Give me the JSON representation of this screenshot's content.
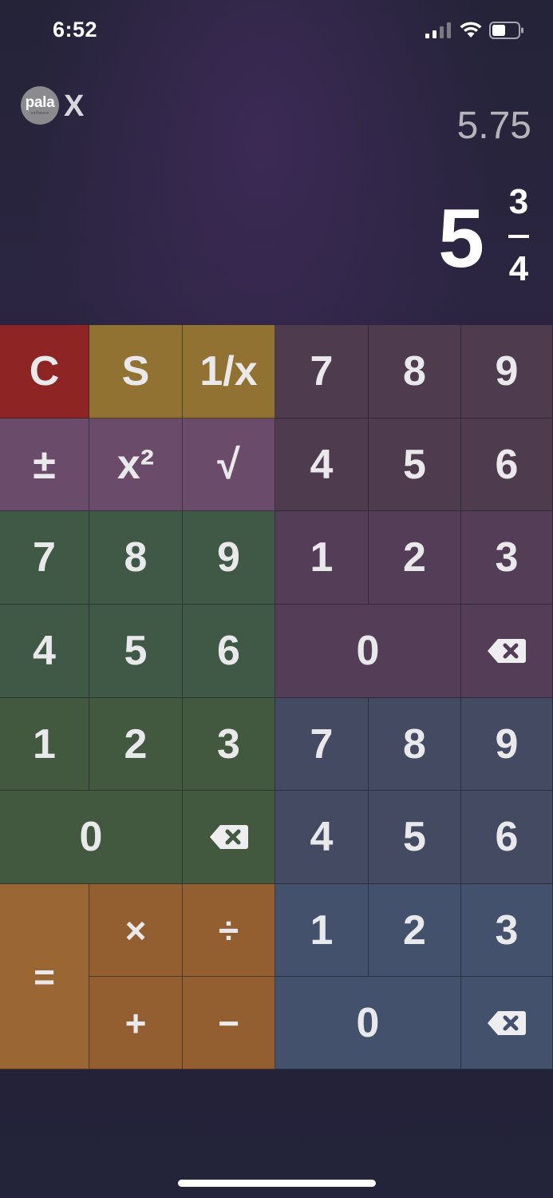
{
  "status": {
    "time": "6:52"
  },
  "logo": {
    "brand": "pala",
    "sub": "software",
    "x_label": "X"
  },
  "display": {
    "decimal": "5.75",
    "fraction": {
      "whole": "5",
      "numerator": "3",
      "denominator": "4"
    }
  },
  "keys": {
    "clear": "C",
    "s": "S",
    "reciprocal": "1/x",
    "plusminus": "±",
    "square": "x²",
    "sqrt": "√",
    "equals": "=",
    "multiply": "×",
    "divide": "÷",
    "plus": "+",
    "minus": "−",
    "whole": {
      "d7": "7",
      "d8": "8",
      "d9": "9",
      "d4": "4",
      "d5": "5",
      "d6": "6",
      "d1": "1",
      "d2": "2",
      "d3": "3",
      "d0": "0"
    },
    "numerator": {
      "d7": "7",
      "d8": "8",
      "d9": "9",
      "d4": "4",
      "d5": "5",
      "d6": "6",
      "d1": "1",
      "d2": "2",
      "d3": "3",
      "d0": "0"
    },
    "denominator": {
      "d7": "7",
      "d8": "8",
      "d9": "9",
      "d4": "4",
      "d5": "5",
      "d6": "6",
      "d1": "1",
      "d2": "2",
      "d3": "3",
      "d0": "0"
    }
  },
  "colors": {
    "clear": "#8f2424",
    "function_gold": "#927232",
    "function_pink": "#6a4b69",
    "whole_pad": "#3f5946",
    "numerator_pad": "#4e3c4e",
    "denominator_pad": "#434a62",
    "operators": "#935f31"
  }
}
